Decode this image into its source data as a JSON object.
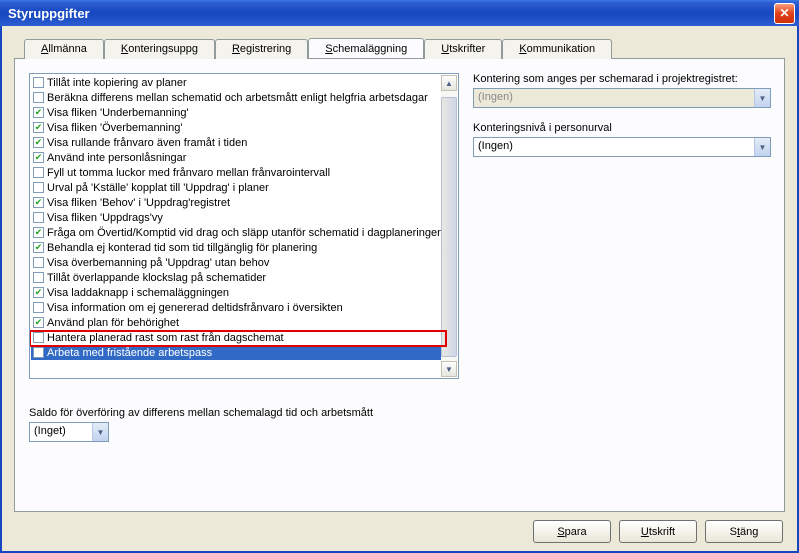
{
  "window": {
    "title": "Styruppgifter",
    "close_icon": "✕"
  },
  "tabs": [
    {
      "label": "Allmänna",
      "accel": "A"
    },
    {
      "label": "Konteringsuppg",
      "accel": "K"
    },
    {
      "label": "Registrering",
      "accel": "R"
    },
    {
      "label": "Schemaläggning",
      "accel": "S",
      "active": true
    },
    {
      "label": "Utskrifter",
      "accel": "U"
    },
    {
      "label": "Kommunikation",
      "accel": "K"
    }
  ],
  "options": [
    {
      "checked": false,
      "label": "Tillåt inte kopiering av planer"
    },
    {
      "checked": false,
      "label": "Beräkna differens mellan schematid och arbetsmått enligt helgfria arbetsdagar"
    },
    {
      "checked": true,
      "label": "Visa fliken 'Underbemanning'"
    },
    {
      "checked": true,
      "label": "Visa fliken 'Överbemanning'"
    },
    {
      "checked": true,
      "label": "Visa rullande frånvaro även framåt i tiden"
    },
    {
      "checked": true,
      "label": "Använd inte personlåsningar"
    },
    {
      "checked": false,
      "label": "Fyll ut tomma luckor med frånvaro mellan frånvarointervall"
    },
    {
      "checked": false,
      "label": "Urval på 'Kställe' kopplat till 'Uppdrag' i planer"
    },
    {
      "checked": true,
      "label": "Visa fliken 'Behov' i 'Uppdrag'registret"
    },
    {
      "checked": false,
      "label": "Visa fliken 'Uppdrags'vy"
    },
    {
      "checked": true,
      "label": "Fråga om Övertid/Komptid vid drag och släpp utanför schematid i dagplaneringen"
    },
    {
      "checked": true,
      "label": "Behandla ej konterad tid som tid tillgänglig för planering"
    },
    {
      "checked": false,
      "label": "Visa överbemanning på 'Uppdrag' utan behov"
    },
    {
      "checked": false,
      "label": "Tillåt överlappande klockslag på schematider"
    },
    {
      "checked": true,
      "label": "Visa laddaknapp i schemaläggningen"
    },
    {
      "checked": false,
      "label": "Visa information om ej genererad deltidsfrånvaro i översikten"
    },
    {
      "checked": true,
      "label": "Använd plan för behörighet",
      "highlighted": true
    },
    {
      "checked": false,
      "label": "Hantera planerad rast som rast från dagschemat"
    },
    {
      "checked": false,
      "label": "Arbeta med fristående arbetspass",
      "selected": true
    }
  ],
  "saldo": {
    "label": "Saldo för överföring av differens mellan schemalagd tid och arbetsmått",
    "value": "(Inget)"
  },
  "right": {
    "kontering_label": "Kontering som anges per schemarad i projektregistret:",
    "kontering_value": "(Ingen)",
    "konteringsniva_label": "Konteringsnivå i personurval",
    "konteringsniva_value": "(Ingen)"
  },
  "footer": {
    "save": "Spara",
    "print": "Utskrift",
    "close": "Stäng"
  }
}
